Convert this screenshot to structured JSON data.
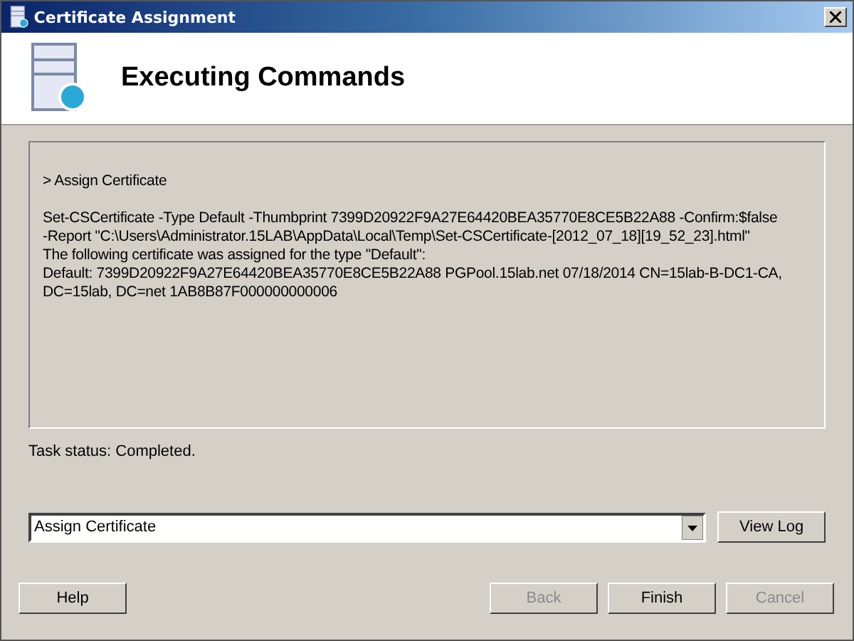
{
  "window": {
    "title": "Certificate Assignment"
  },
  "header": {
    "title": "Executing Commands"
  },
  "output": {
    "blocks": [
      [
        "> Assign Certificate"
      ],
      [
        "Set-CSCertificate -Type Default -Thumbprint 7399D20922F9A27E64420BEA35770E8CE5B22A88 -Confirm:$false",
        "-Report \"C:\\Users\\Administrator.15LAB\\AppData\\Local\\Temp\\Set-CSCertificate-[2012_07_18][19_52_23].html\"",
        "The following certificate was assigned for the type \"Default\":",
        "Default: 7399D20922F9A27E64420BEA35770E8CE5B22A88 PGPool.15lab.net 07/18/2014 CN=15lab-B-DC1-CA,",
        "DC=15lab, DC=net 1AB8B87F000000000006"
      ]
    ]
  },
  "task_status": "Task status: Completed.",
  "task_select": {
    "value": "Assign Certificate"
  },
  "view_log_button": {
    "label": "View Log",
    "disabled": false
  },
  "buttons": [
    {
      "label": "Help",
      "disabled": false
    },
    {
      "label": "Back",
      "disabled": true
    },
    {
      "label": "Finish",
      "disabled": false
    },
    {
      "label": "Cancel",
      "disabled": true
    }
  ]
}
